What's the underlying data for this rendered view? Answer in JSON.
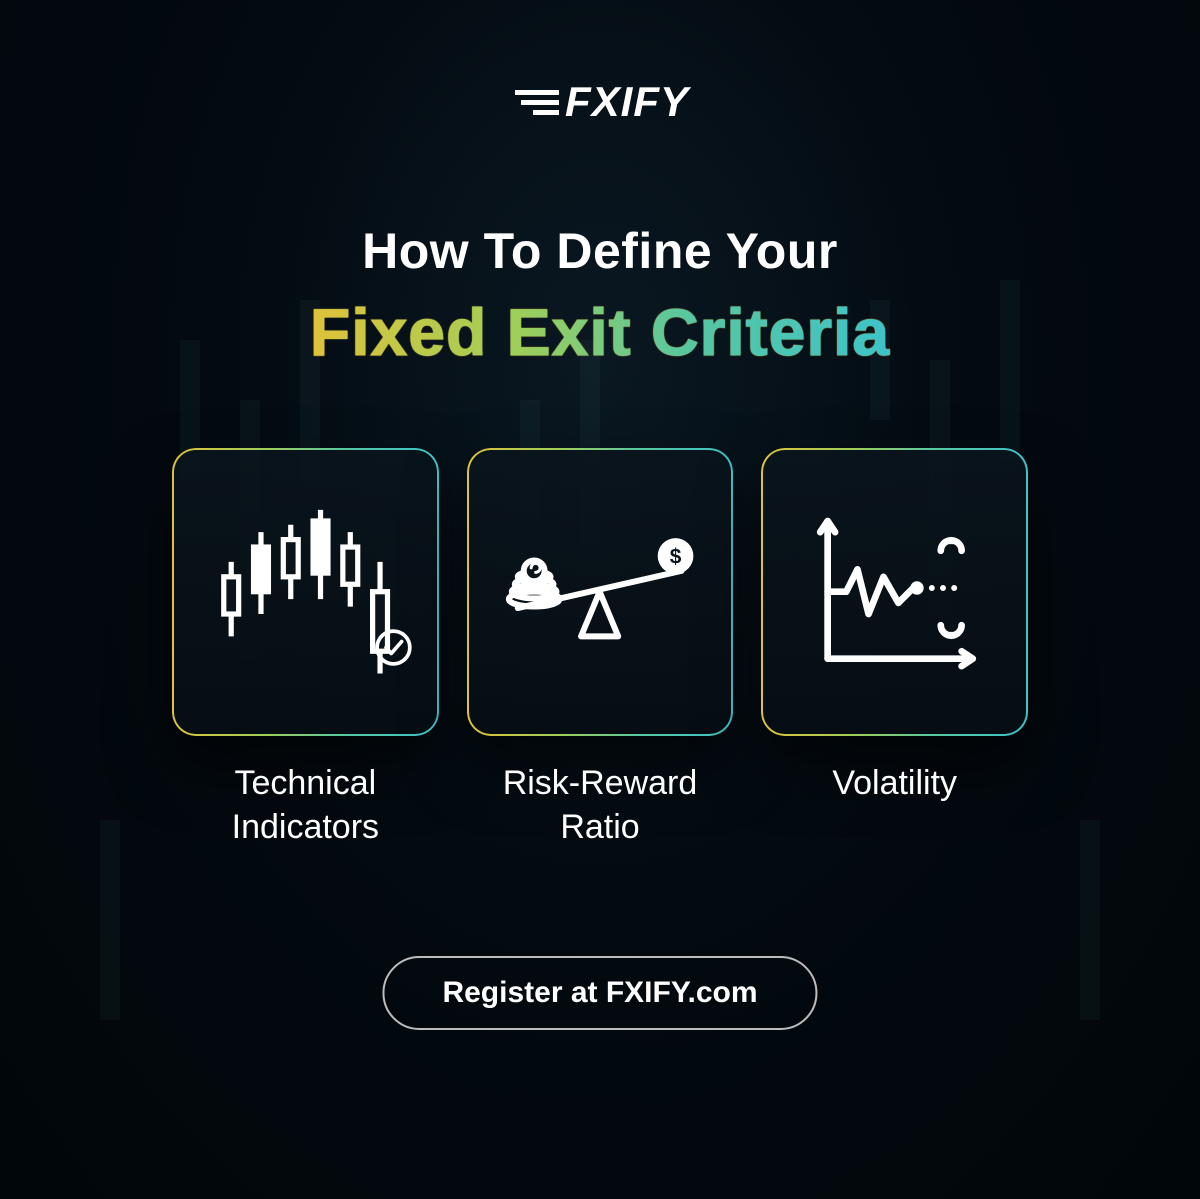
{
  "logo_text": "FXIFY",
  "headline_line1": "How To Define Your",
  "headline_line2": "Fixed Exit Criteria",
  "cards": [
    {
      "label": "Technical Indicators",
      "icon": "candlestick-icon"
    },
    {
      "label": "Risk-Reward Ratio",
      "icon": "scale-icon"
    },
    {
      "label": "Volatility",
      "icon": "volatility-chart-icon"
    }
  ],
  "cta_label": "Register at FXIFY.com",
  "colors": {
    "gradient": [
      "#e0c23a",
      "#9fcf58",
      "#57c7a1",
      "#3ec3c9"
    ],
    "bg": "#030a10"
  }
}
